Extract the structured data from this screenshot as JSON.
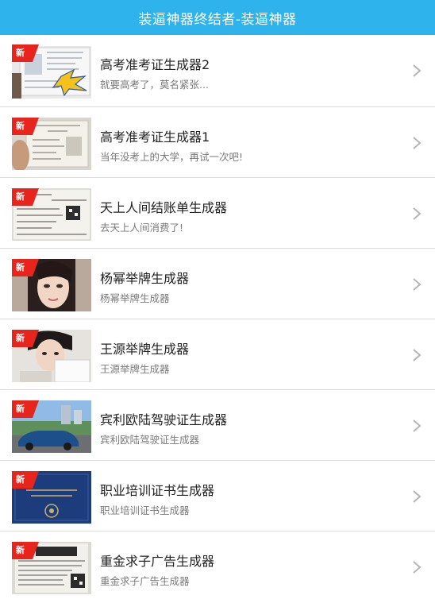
{
  "header": {
    "title": "装逼神器终结者-装逼神器"
  },
  "items": [
    {
      "badge": "新",
      "title": "高考准考证生成器2",
      "subtitle": "就要高考了，莫名紧张...",
      "thumb": "exam-ticket-photo"
    },
    {
      "badge": "新",
      "title": "高考准考证生成器1",
      "subtitle": "当年没考上的大学，再试一次吧!",
      "thumb": "exam-ticket-photo"
    },
    {
      "badge": "新",
      "title": "天上人间结账单生成器",
      "subtitle": "去天上人间消费了!",
      "thumb": "receipt-photo"
    },
    {
      "badge": "新",
      "title": "杨幂举牌生成器",
      "subtitle": "杨幂举牌生成器",
      "thumb": "woman-portrait-photo"
    },
    {
      "badge": "新",
      "title": "王源举牌生成器",
      "subtitle": "王源举牌生成器",
      "thumb": "boy-holding-sign-photo"
    },
    {
      "badge": "新",
      "title": "宾利欧陆驾驶证生成器",
      "subtitle": "宾利欧陆驾驶证生成器",
      "thumb": "car-street-photo"
    },
    {
      "badge": "新",
      "title": "职业培训证书生成器",
      "subtitle": "职业培训证书生成器",
      "thumb": "certificate-cover-photo"
    },
    {
      "badge": "新",
      "title": "重金求子广告生成器",
      "subtitle": "重金求子广告生成器",
      "thumb": "poster-ad-photo"
    }
  ],
  "colors": {
    "header_bg": "#2fb3ec",
    "badge_red": "#e8251c",
    "chevron": "#b5b5b5"
  }
}
